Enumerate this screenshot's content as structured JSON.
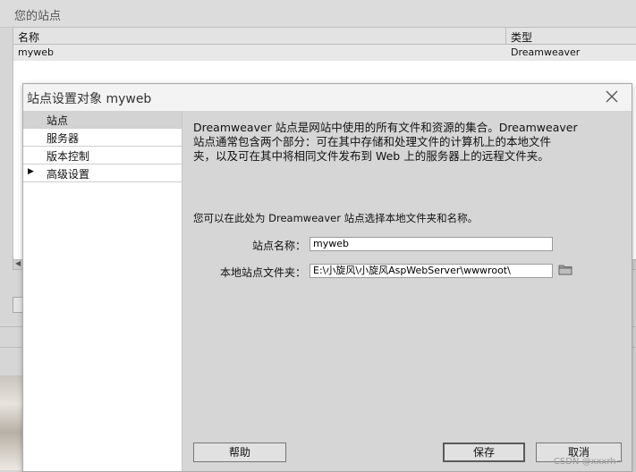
{
  "background": {
    "title": "您的站点",
    "columns": [
      "名称",
      "类型"
    ],
    "row": {
      "name": "myweb",
      "type": "Dreamweaver"
    }
  },
  "dialog": {
    "title": "站点设置对象 myweb",
    "nav": [
      {
        "label": "站点",
        "selected": true
      },
      {
        "label": "服务器"
      },
      {
        "label": "版本控制"
      },
      {
        "label": "高级设置",
        "expandable": true
      }
    ],
    "intro_lines": [
      "Dreamweaver 站点是网站中使用的所有文件和资源的集合。Dreamweaver",
      "站点通常包含两个部分：可在其中存储和处理文件的计算机上的本地文件",
      "夹，以及可在其中将相同文件发布到 Web 上的服务器上的远程文件夹。"
    ],
    "choose_text": "您可以在此处为 Dreamweaver 站点选择本地文件夹和名称。",
    "site_name": {
      "label": "站点名称：",
      "value": "myweb"
    },
    "local_folder": {
      "label": "本地站点文件夹：",
      "value": "E:\\小旋风\\小旋风AspWebServer\\wwwroot\\"
    },
    "buttons": {
      "help": "帮助",
      "save": "保存",
      "cancel": "取消"
    }
  },
  "watermark": "CSDN @xxxrh~"
}
